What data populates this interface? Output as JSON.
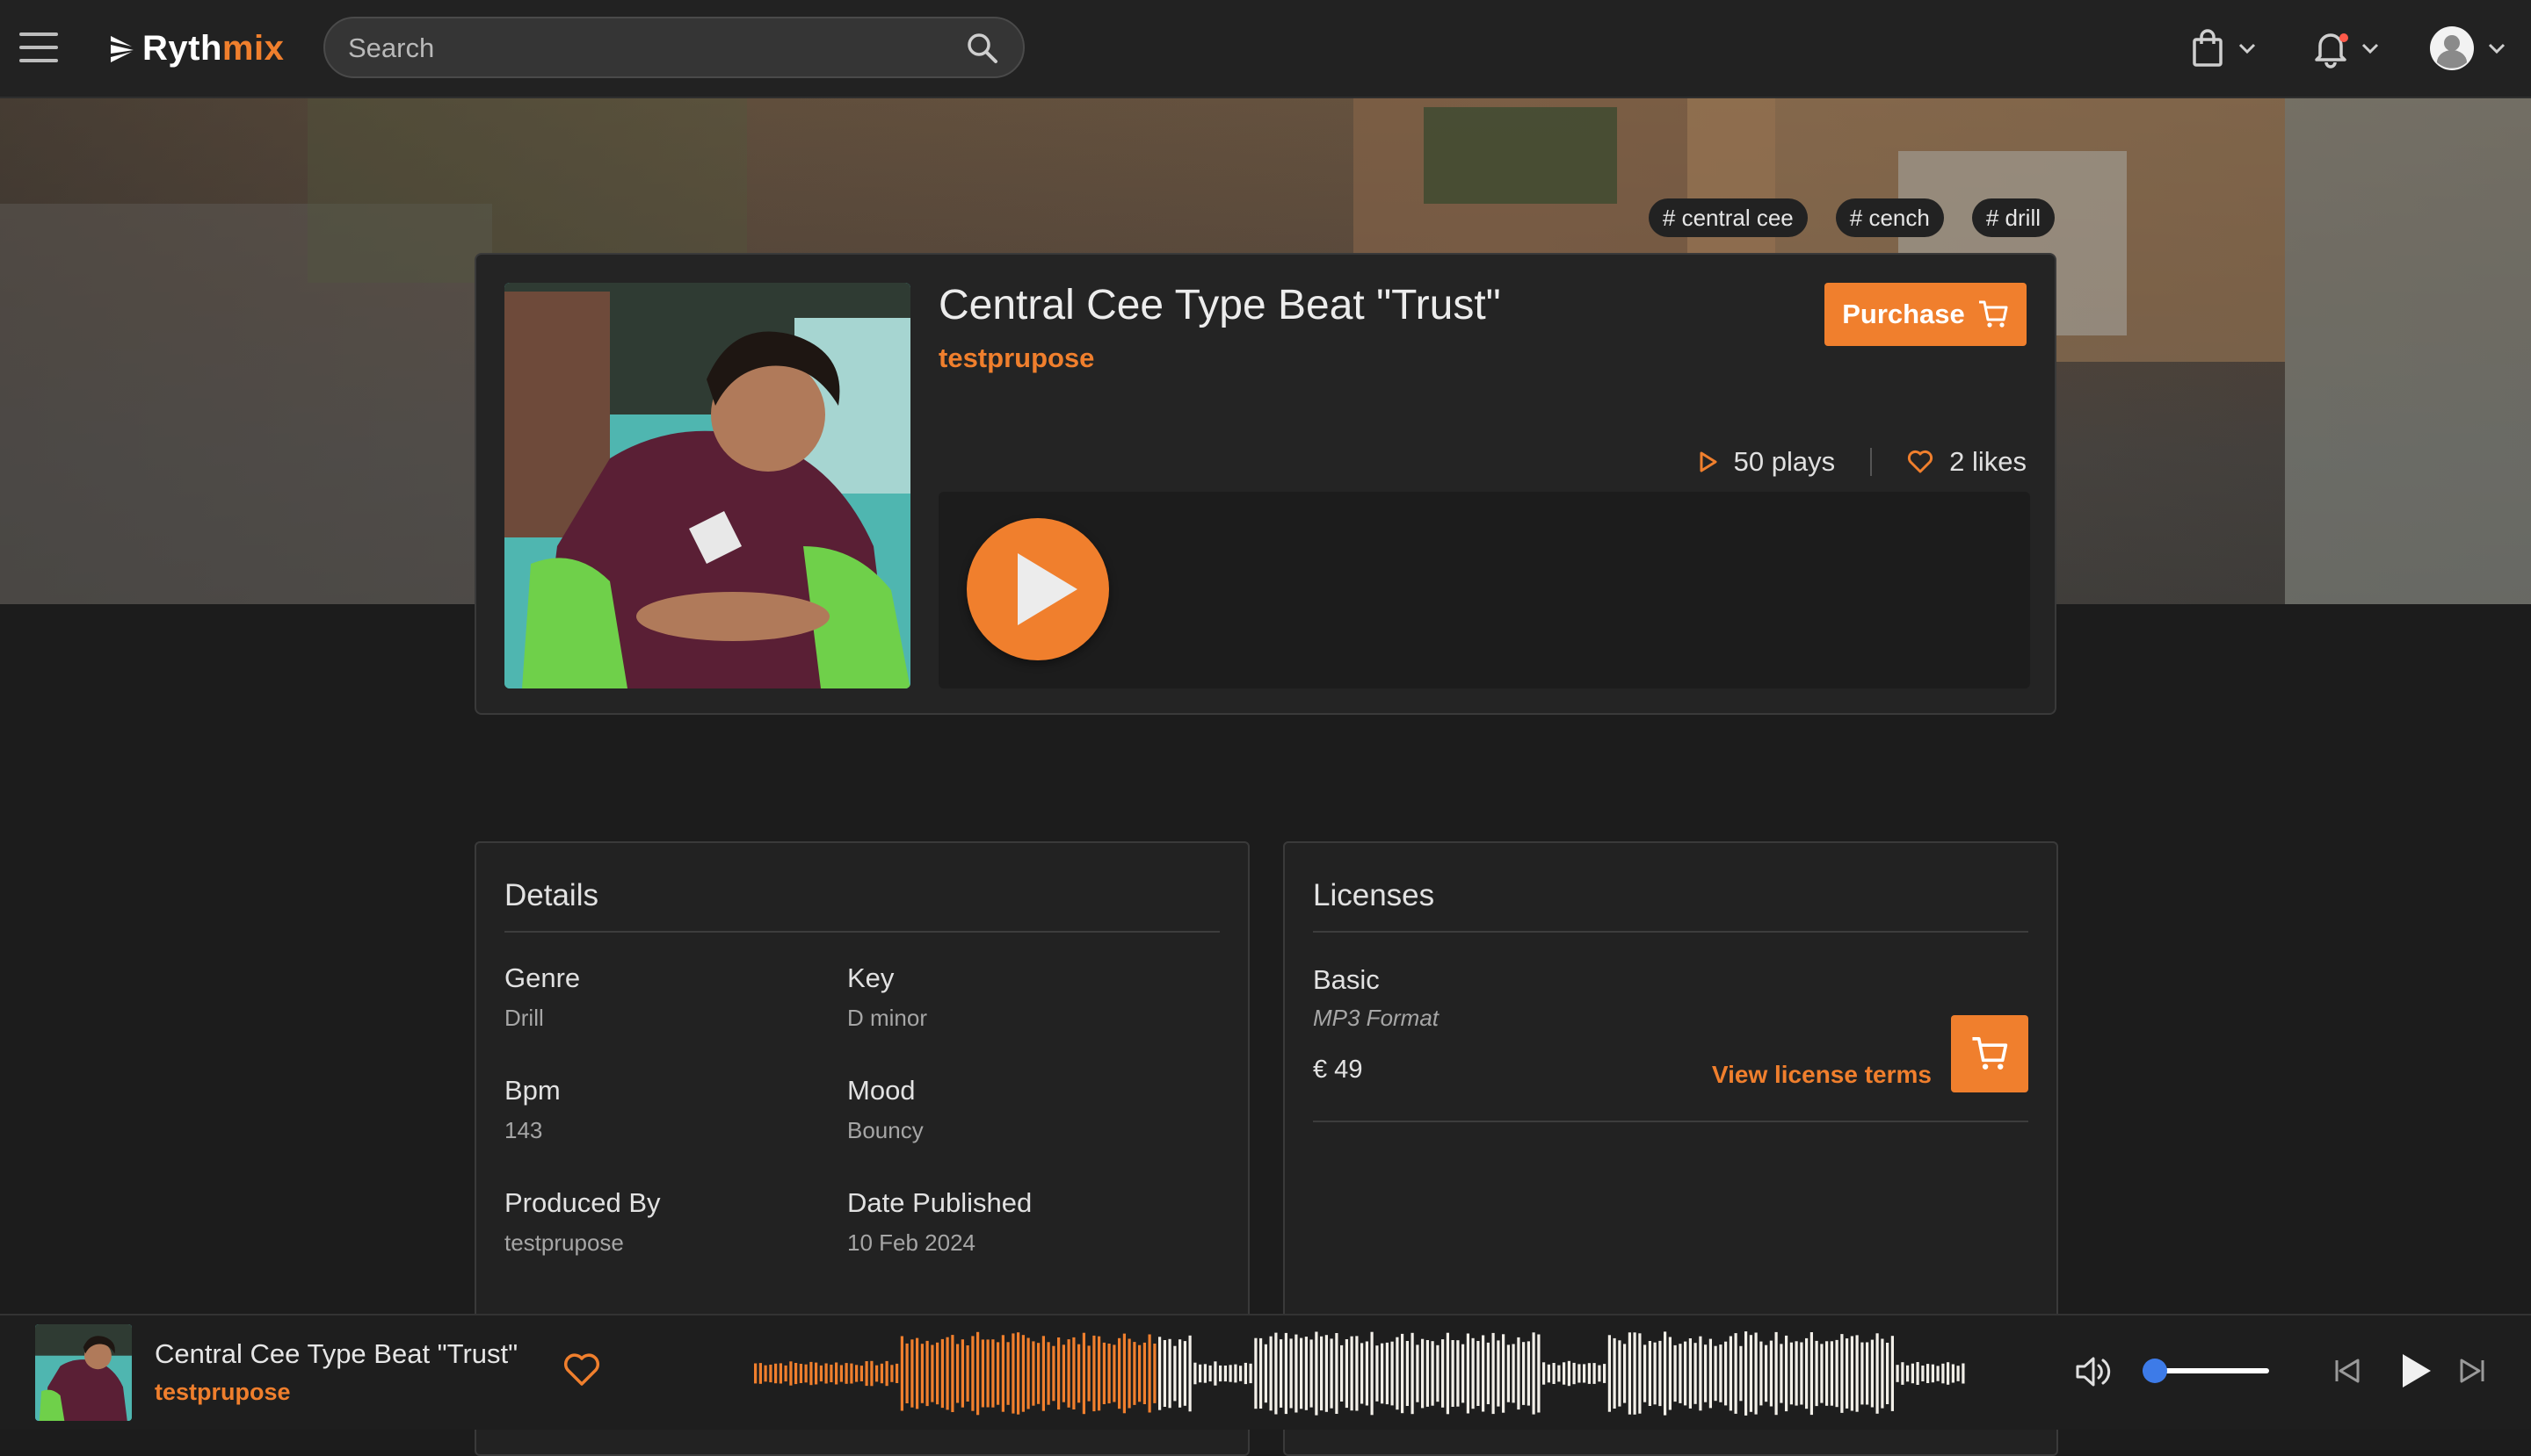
{
  "header": {
    "logo_part1": "Ryth",
    "logo_part2": "mix",
    "search_placeholder": "Search"
  },
  "beat": {
    "tags": [
      "# central cee",
      "# cench",
      "# drill"
    ],
    "title": "Central Cee Type Beat \"Trust\"",
    "artist": "testprupose",
    "purchase_label": "Purchase",
    "plays_label": "50 plays",
    "likes_label": "2 likes"
  },
  "details": {
    "heading": "Details",
    "items": [
      {
        "label": "Genre",
        "value": "Drill"
      },
      {
        "label": "Key",
        "value": "D minor"
      },
      {
        "label": "Bpm",
        "value": "143"
      },
      {
        "label": "Mood",
        "value": "Bouncy"
      },
      {
        "label": "Produced By",
        "value": "testprupose"
      },
      {
        "label": "Date Published",
        "value": "10 Feb 2024"
      }
    ]
  },
  "licenses": {
    "heading": "Licenses",
    "items": [
      {
        "name": "Basic",
        "format": "MP3 Format",
        "price": "€ 49",
        "terms_label": "View license terms"
      }
    ]
  },
  "player": {
    "title": "Central Cee Type Beat \"Trust\"",
    "artist": "testprupose",
    "progress": 0.33,
    "volume": 0.1
  },
  "colors": {
    "accent": "#f07f2d",
    "volume_accent": "#3d7be8",
    "background": "#1c1c1c"
  },
  "icons": [
    "menu-icon",
    "search-icon",
    "shopping-bag-icon",
    "bell-icon",
    "user-avatar-icon",
    "play-icon",
    "heart-icon",
    "cart-icon",
    "volume-icon",
    "skip-previous-icon",
    "skip-next-icon"
  ]
}
